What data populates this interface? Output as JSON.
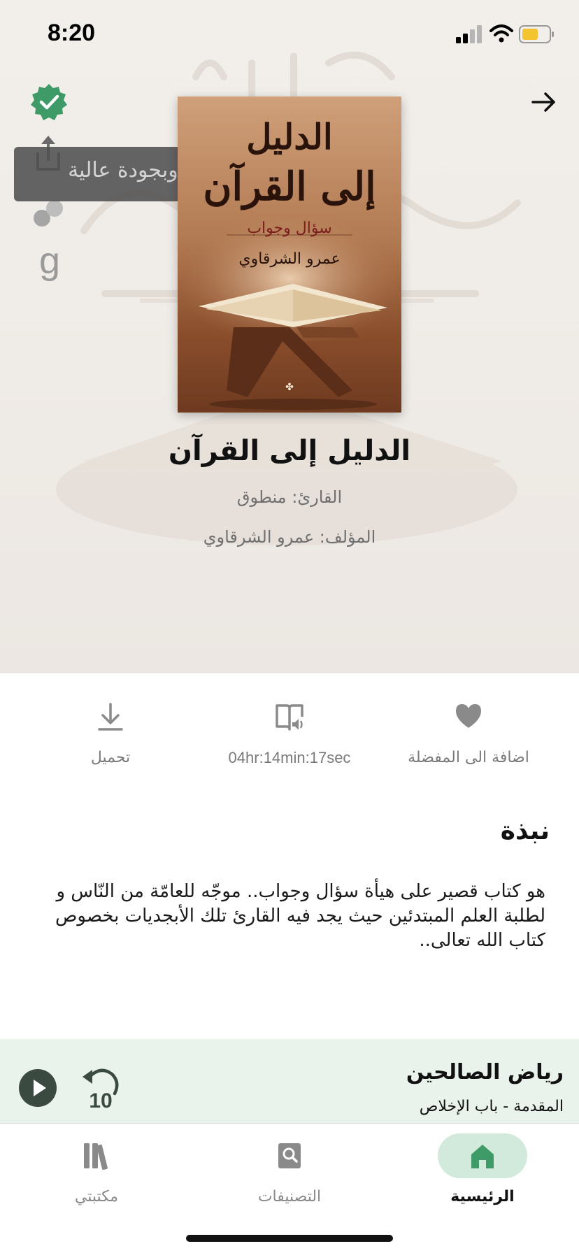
{
  "status_bar": {
    "time": "8:20"
  },
  "tooltip": {
    "text": "مكتمل وبجودة عالية"
  },
  "cover": {
    "title_line1": "الدليل",
    "title_line2": "إلى القرآن",
    "subtitle": "سؤال وجواب",
    "author": "عمرو الشرقاوي"
  },
  "book": {
    "title": "الدليل إلى القرآن",
    "narrator": "القارئ: منطوق",
    "author": "المؤلف: عمرو الشرقاوي"
  },
  "actions": {
    "download_label": "تحميل",
    "duration_label": "04hr:14min:17sec",
    "favorite_label": "اضافة الى المفضلة"
  },
  "about": {
    "heading": "نبذة",
    "body": "هو  كتاب قصير على هيأة سؤال وجواب.. موجّه للعامّة من النّاس و لطلبة العلم  المبتدئين حيث يجد فيه القارئ تلك الأبجديات بخصوص كتاب الله تعالى.."
  },
  "mini_player": {
    "title": "رياض الصالحين",
    "subtitle": "المقدمة - باب الإخلاص",
    "rewind_seconds": "10"
  },
  "tabs": {
    "library": "مكتبتي",
    "categories": "التصنيفات",
    "home": "الرئيسية"
  },
  "colors": {
    "accent_green": "#3e9a66",
    "selected_tab_bg": "#d2eadb",
    "mini_player_bg": "#eaf2ec",
    "icon_gray": "#8a8a8a",
    "player_dark": "#3a4a40"
  },
  "icons": {
    "verified": "verified-badge-icon",
    "share": "share-icon",
    "chat": "chat-icon",
    "goodreads": "goodreads-icon",
    "back": "arrow-right-icon",
    "download": "download-icon",
    "audiobook": "audiobook-icon",
    "favorite": "heart-icon",
    "play": "play-icon",
    "rewind": "rewind-10-icon",
    "library": "books-icon",
    "categories": "search-book-icon",
    "home": "home-icon"
  }
}
